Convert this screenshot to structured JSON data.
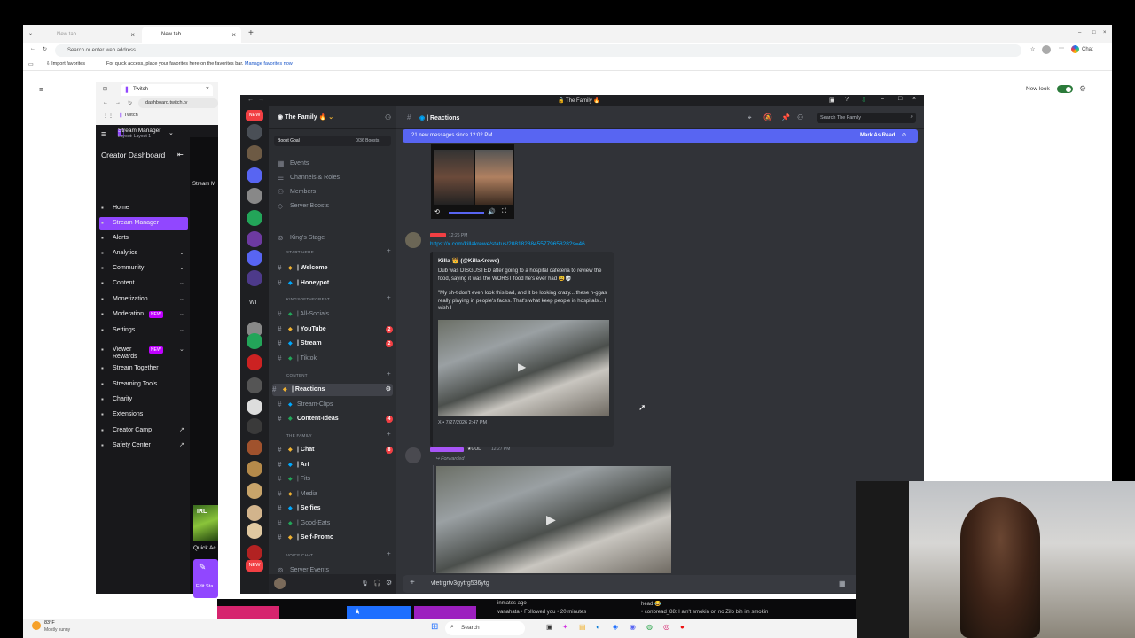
{
  "browser": {
    "tabs": [
      "New tab",
      "New tab"
    ],
    "new_tab_symbol": "+",
    "address_placeholder": "Search or enter web address",
    "favbar_import": "Import favorites",
    "favbar_text": "For quick access, place your favorites here on the favorites bar.",
    "favbar_link": "Manage favorites now",
    "chat_label": "Chat",
    "new_look_label": "New look",
    "accent": "#2b7a3a"
  },
  "twitch": {
    "tab_title": "Twitch",
    "url": "dashboard.twitch.tv",
    "tab_label": "Twitch",
    "stream_manager": "Stream Manager",
    "layout": "Layout: Layout 1",
    "creator_dashboard": "Creator Dashboard",
    "side_label": "Stream M",
    "quick_actions": "Quick Ac",
    "edit_label": "Edit Sta",
    "new_badge": "NEW",
    "nav": [
      {
        "label": "Home",
        "icon": "home-icon"
      },
      {
        "label": "Stream Manager",
        "icon": "stream-icon",
        "active": true
      },
      {
        "label": "Alerts",
        "icon": "alert-icon"
      },
      {
        "label": "Analytics",
        "icon": "analytics-icon",
        "chevron": true
      },
      {
        "label": "Community",
        "icon": "community-icon",
        "chevron": true
      },
      {
        "label": "Content",
        "icon": "content-icon",
        "chevron": true
      },
      {
        "label": "Monetization",
        "icon": "money-icon",
        "chevron": true
      },
      {
        "label": "Moderation",
        "icon": "sword-icon",
        "chevron": true,
        "badge": "NEW"
      },
      {
        "label": "Settings",
        "icon": "gear-icon",
        "chevron": true
      },
      {
        "label": "Viewer Rewards",
        "icon": "reward-icon",
        "chevron": true,
        "badge": "NEW"
      },
      {
        "label": "Stream Together",
        "icon": "together-icon"
      },
      {
        "label": "Streaming Tools",
        "icon": "tools-icon"
      },
      {
        "label": "Charity",
        "icon": "heart-icon"
      },
      {
        "label": "Extensions",
        "icon": "extension-icon"
      },
      {
        "label": "Creator Camp",
        "icon": "camp-icon",
        "external": true
      },
      {
        "label": "Safety Center",
        "icon": "shield-icon",
        "external": true
      }
    ]
  },
  "discord": {
    "window_title": "The Family",
    "server_name": "The Family",
    "boost_goal": "Boost Goal",
    "boosts": "0/36 Boosts",
    "new_badge": "NEW",
    "wi_label": "WI",
    "misc_menu": [
      "Events",
      "Channels & Roles",
      "Members",
      "Server Boosts"
    ],
    "stage": "King's Stage",
    "categories": [
      "START HERE",
      "KINGSOFTHEGREAT",
      "CONTENT",
      "THE FAMILY",
      "VOICE CHAT"
    ],
    "channels": [
      {
        "label": "| Welcome",
        "bold": true
      },
      {
        "label": "| Honeypot",
        "bold": true
      },
      {
        "label": "| All-Socials",
        "bold": false
      },
      {
        "label": "| YouTube",
        "bold": true,
        "badge": "2"
      },
      {
        "label": "| Stream",
        "bold": true,
        "badge": "2"
      },
      {
        "label": "| Tiktok",
        "bold": false
      },
      {
        "label": "| Reactions",
        "bold": true,
        "active": true
      },
      {
        "label": "Stream-Clips",
        "bold": false
      },
      {
        "label": "Content-Ideas",
        "bold": true,
        "badge": "4"
      },
      {
        "label": "| Chat",
        "bold": true,
        "badge": "8"
      },
      {
        "label": "| Art",
        "bold": true
      },
      {
        "label": "| Fits",
        "bold": false
      },
      {
        "label": "| Media",
        "bold": false
      },
      {
        "label": "| Selfies",
        "bold": true
      },
      {
        "label": "| Good-Eats",
        "bold": false
      },
      {
        "label": "| Self-Promo",
        "bold": true
      }
    ],
    "voice_label": "Server Events",
    "server_badges": [
      "1",
      "1",
      "1",
      "1",
      "9",
      "6",
      "1",
      "4",
      "242",
      "1",
      "135",
      "1",
      "118",
      "1",
      "29",
      "143"
    ],
    "channel_header": "| Reactions",
    "search_placeholder": "Search The Family",
    "banner_text": "21 new messages since 12:02 PM",
    "banner_action": "Mark As Read",
    "msg1_time": "12:26 PM",
    "msg1_link": "https://x.com/killakrewe/status/2081828845577965828?s=46",
    "embed_author": "Killa 👑 (@KillaKrewe)",
    "embed_text1": "Dub was DISGUSTED after going to a hospital cafeteria to review the food, saying it was the WORST food he's ever had 😩💀",
    "embed_text2": "\"My sh-t don't even look this bad, and it be looking crazy... these n-ggas really playing in people's faces. That's what keep people in hospitals... I wish I",
    "embed_footer": "X • 7/27/2026 2:47 PM",
    "msg2_tag": "★GOD",
    "msg2_time": "12:27 PM",
    "forwarded": "Forwarded",
    "input_text": "vfetrgrtv3gytrg536ytg"
  },
  "taskbar": {
    "weather_temp": "83°F",
    "weather_desc": "Mostly sunny",
    "search": "Search"
  },
  "stream_chat": {
    "line1": "inmates ago",
    "line2": "vanahata • Followed you • 20 minutes",
    "line3": "head 😂",
    "line4": "• conbread_88: I ain't smokin on no Zilo bih im smokin"
  }
}
